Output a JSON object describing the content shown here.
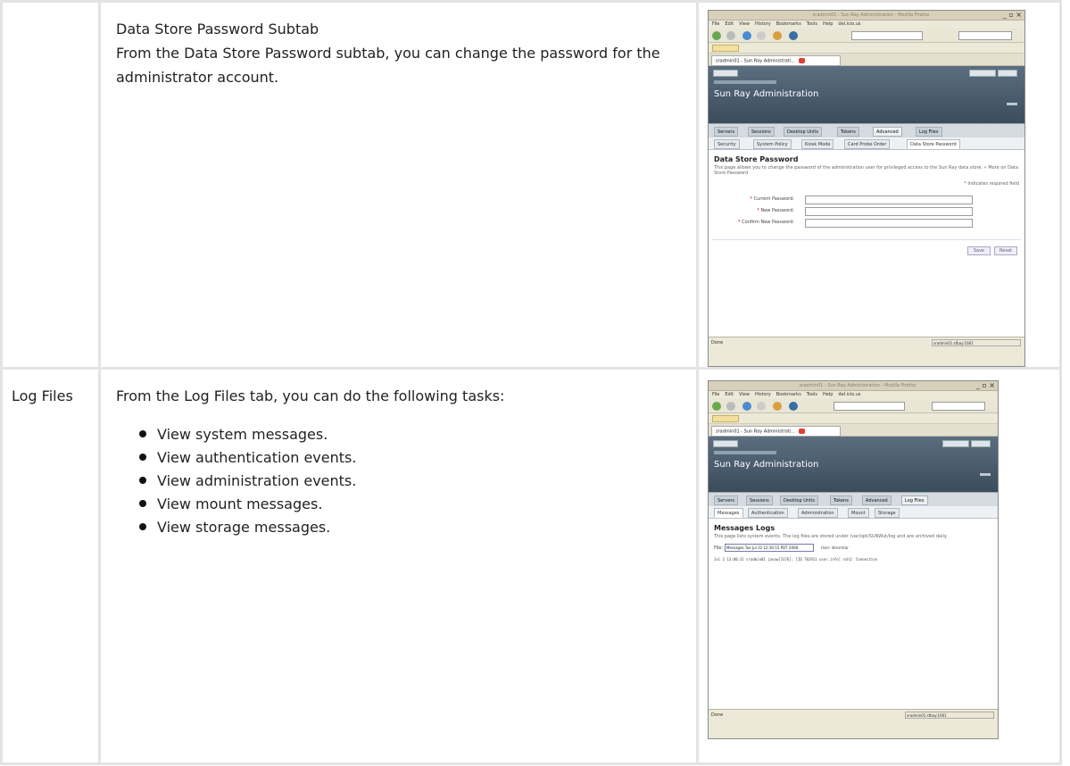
{
  "rows": [
    {
      "label": "",
      "title": "Data Store Password Subtab",
      "description": "From the Data Store Password subtab, you can change the password for the administrator account.",
      "screenshot": {
        "window_title": "sradmin01 - Sun Ray Administration - Mozilla Firefox",
        "menus": [
          "File",
          "Edit",
          "View",
          "History",
          "Bookmarks",
          "Tools",
          "Help",
          "del.icio.us"
        ],
        "bookmark_folder": "Bookmarks",
        "browser_tab": "sradmin01 - Sun Ray Administrati...",
        "app_title": "Sun Ray Administration",
        "top_buttons": [
          "CONSOLE",
          "LOG OUT",
          "HELP"
        ],
        "main_tabs": [
          "Servers",
          "Sessions",
          "Desktop Units",
          "Tokens",
          "Advanced",
          "Log Files"
        ],
        "active_main_tab": "Advanced",
        "sub_tabs": [
          "Security",
          "System Policy",
          "Kiosk Mode",
          "Card Probe Order",
          "Data Store Password"
        ],
        "active_sub_tab": "Data Store Password",
        "page_heading": "Data Store Password",
        "page_description": "This page allows you to change the password of the administration user for privileged access to the Sun Ray data store. » More on Data Store Password",
        "required_note": "* Indicates required field",
        "fields": [
          "Current Password:",
          "New Password:",
          "Confirm New Password:"
        ],
        "buttons": [
          "Save",
          "Reset"
        ],
        "status_left": "Done",
        "status_right": "sradmin01.sfbay:1661"
      }
    },
    {
      "label": "Log Files",
      "intro": "From the Log Files tab, you can do the following tasks:",
      "tasks": [
        "View system messages.",
        "View authentication events.",
        "View administration events.",
        "View mount messages.",
        "View storage messages."
      ],
      "screenshot": {
        "window_title": "sradmin01 - Sun Ray Administration - Mozilla Firefox",
        "menus": [
          "File",
          "Edit",
          "View",
          "History",
          "Bookmarks",
          "Tools",
          "Help",
          "del.icio.us"
        ],
        "bookmark_folder": "Bookmarks",
        "browser_tab": "sradmin01 - Sun Ray Administrati...",
        "app_title": "Sun Ray Administration",
        "top_buttons": [
          "CONSOLE",
          "LOG OUT",
          "HELP"
        ],
        "main_tabs": [
          "Servers",
          "Sessions",
          "Desktop Units",
          "Tokens",
          "Advanced",
          "Log Files"
        ],
        "active_main_tab": "Log Files",
        "sub_tabs": [
          "Messages",
          "Authentication",
          "Administration",
          "Mount",
          "Storage"
        ],
        "active_sub_tab": "Messages",
        "page_heading": "Messages Logs",
        "page_description": "This page lists system events. The log files are stored under /var/opt/SUNWut/log and are archived daily.",
        "file_label": "File:",
        "file_value": "Messages Tue Jul 22 12:30:15 PDT 2008",
        "user_label": "User: ldmsmtar",
        "log_line": "Jul  2 13:00:31 sradmin01 javaw[3176]: [ID 702911 user.info] ssh2: Connection",
        "status_left": "Done",
        "status_right": "sradmin01.sfbay:1661"
      }
    }
  ]
}
